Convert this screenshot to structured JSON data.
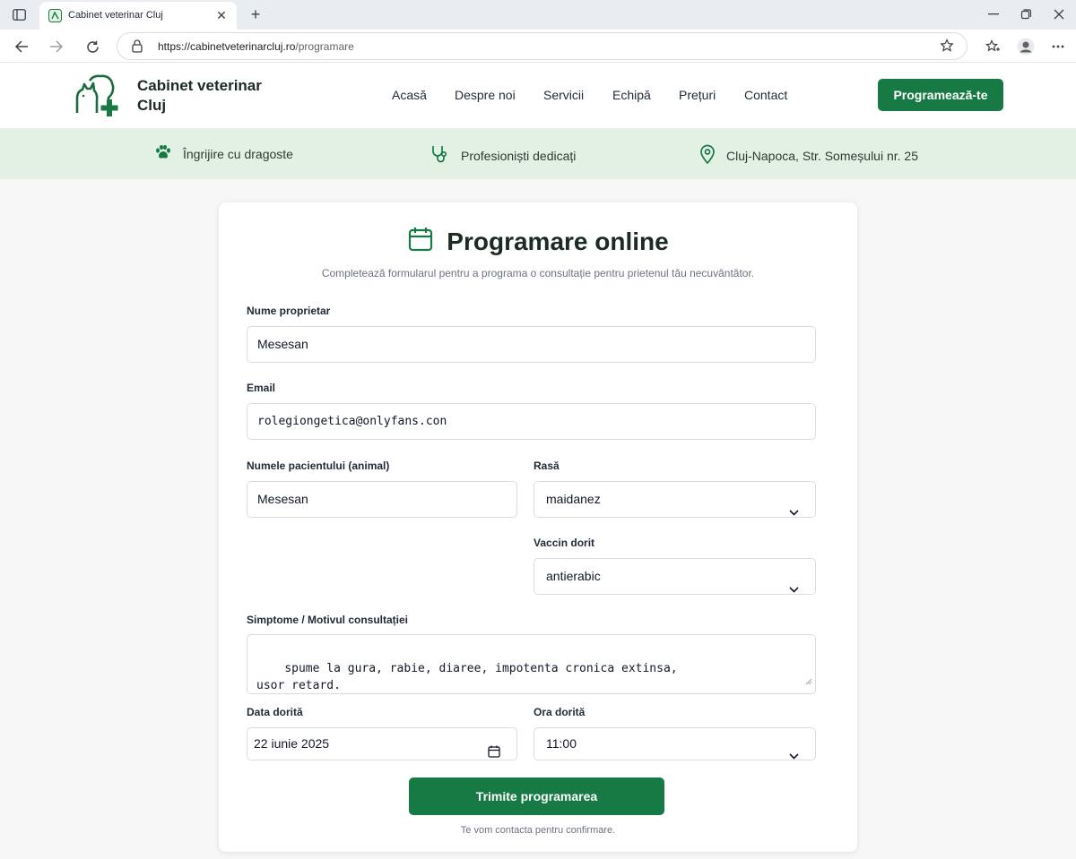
{
  "browser": {
    "tab_title": "Cabinet veterinar Cluj",
    "url_host": "https://cabinetveterinarcluj.ro",
    "url_path": "/programare",
    "tab_close": "✕",
    "new_tab": "+"
  },
  "site": {
    "brand": "Cabinet veterinar Cluj",
    "nav": [
      "Acasă",
      "Despre noi",
      "Servicii",
      "Echipă",
      "Prețuri",
      "Contact"
    ],
    "cta": "Programează-te",
    "accent_color": "#177a45",
    "strip_color": "#e3f1e4"
  },
  "features": [
    {
      "icon": "paw-icon",
      "text": "Îngrijire cu dragoste"
    },
    {
      "icon": "stethoscope-icon",
      "text": "Profesioniști dedicați"
    },
    {
      "icon": "map-pin-icon",
      "text": "Cluj-Napoca, Str. Someșului nr. 25"
    }
  ],
  "form": {
    "title": "Programare online",
    "subtitle": "Completează formularul pentru a programa o consultație pentru prietenul tău necuvântător.",
    "owner_label": "Nume proprietar",
    "owner_value": "Mesesan",
    "email_label": "Email",
    "email_value": "rolegiongetica@onlyfans.con",
    "patient_label": "Numele pacientului (animal)",
    "patient_value": "Mesesan",
    "breed_label": "Rasă",
    "breed_value": "maidanez",
    "vaccine_label": "Vaccin dorit",
    "vaccine_value": "antierabic",
    "symptoms_label": "Simptome / Motivul consultației",
    "symptoms_value": "spume la gura, rabie, diaree, impotenta cronica extinsa,\nusor retard.",
    "date_label": "Data dorită",
    "date_value": "22 iunie 2025",
    "time_label": "Ora dorită",
    "time_value": "11:00",
    "submit": "Trimite programarea",
    "note": "Te vom contacta pentru confirmare."
  }
}
